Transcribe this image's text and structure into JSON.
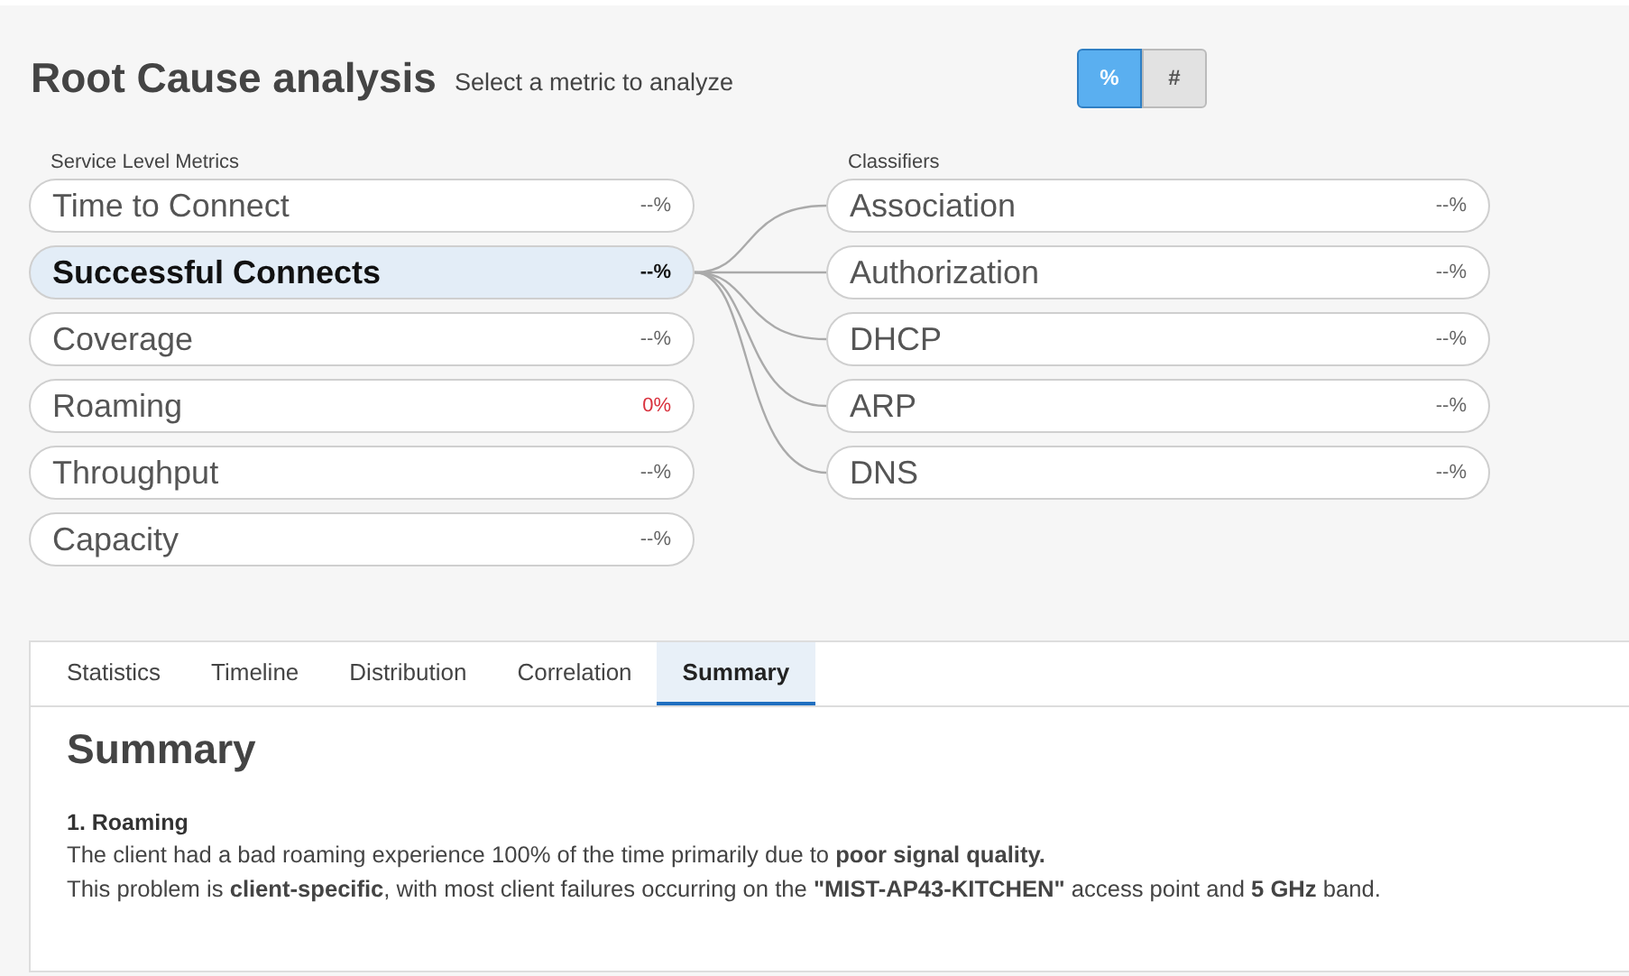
{
  "header": {
    "title": "Root Cause analysis",
    "subtitle": "Select a metric to analyze"
  },
  "unit_toggle": [
    {
      "label": "%",
      "selected": true
    },
    {
      "label": "#",
      "selected": false
    }
  ],
  "service_level_metrics": {
    "label": "Service Level Metrics",
    "items": [
      {
        "name": "Time to Connect",
        "value": "--%",
        "selected": false,
        "alert": false
      },
      {
        "name": "Successful Connects",
        "value": "--%",
        "selected": true,
        "alert": false
      },
      {
        "name": "Coverage",
        "value": "--%",
        "selected": false,
        "alert": false
      },
      {
        "name": "Roaming",
        "value": "0%",
        "selected": false,
        "alert": true
      },
      {
        "name": "Throughput",
        "value": "--%",
        "selected": false,
        "alert": false
      },
      {
        "name": "Capacity",
        "value": "--%",
        "selected": false,
        "alert": false
      }
    ]
  },
  "classifiers": {
    "label": "Classifiers",
    "items": [
      {
        "name": "Association",
        "value": "--%"
      },
      {
        "name": "Authorization",
        "value": "--%"
      },
      {
        "name": "DHCP",
        "value": "--%"
      },
      {
        "name": "ARP",
        "value": "--%"
      },
      {
        "name": "DNS",
        "value": "--%"
      }
    ]
  },
  "tabs": [
    {
      "label": "Statistics",
      "selected": false
    },
    {
      "label": "Timeline",
      "selected": false
    },
    {
      "label": "Distribution",
      "selected": false
    },
    {
      "label": "Correlation",
      "selected": false
    },
    {
      "label": "Summary",
      "selected": true
    }
  ],
  "summary": {
    "heading": "Summary",
    "items": [
      {
        "title": "1. Roaming",
        "lines": [
          "The client had a bad roaming experience 100% of the time primarily due to **poor signal quality.**",
          "This problem is **client-specific**, with most client failures occurring on the **\"MIST-AP43-KITCHEN\"** access point and **5 GHz** band."
        ]
      }
    ]
  }
}
